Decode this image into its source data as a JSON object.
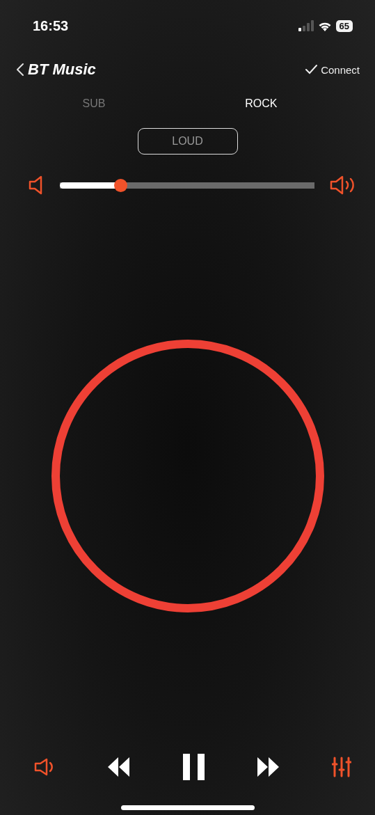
{
  "status_bar": {
    "time": "16:53",
    "battery": "65"
  },
  "header": {
    "title": "BT Music",
    "action": "Connect"
  },
  "tabs": [
    {
      "label": "SUB",
      "selected": false
    },
    {
      "label": "ROCK",
      "selected": true
    }
  ],
  "mode_button": {
    "label": "LOUD"
  },
  "volume": {
    "level": 0.24
  },
  "controls": [
    {
      "kind": "volume"
    },
    {
      "kind": "rewind"
    },
    {
      "kind": "pause"
    },
    {
      "kind": "forward"
    },
    {
      "kind": "equalizer"
    }
  ]
}
